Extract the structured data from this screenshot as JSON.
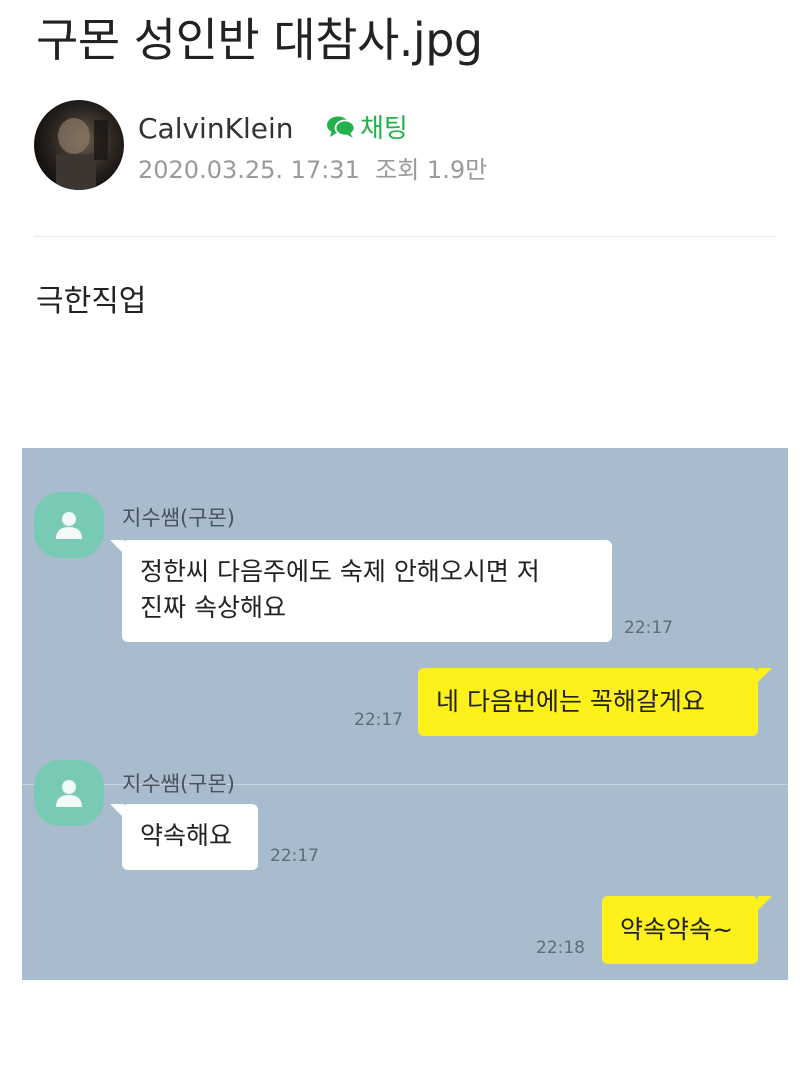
{
  "post": {
    "title": "구몬 성인반 대참사.jpg",
    "author": "CalvinKlein",
    "chat_label": "채팅",
    "date": "2020.03.25. 17:31",
    "views_label": "조회",
    "views": "1.9만",
    "body": "극한직업"
  },
  "chat": {
    "messages": [
      {
        "side": "in",
        "sender": "지수쌤(구몬)",
        "lines": [
          "정한씨 다음주에도 숙제 안해오시면 저",
          "진짜 속상해요"
        ],
        "time": "22:17"
      },
      {
        "side": "out",
        "lines": [
          "네 다음번에는 꼭해갈게요"
        ],
        "time": "22:17"
      },
      {
        "side": "in",
        "sender": "지수쌤(구몬)",
        "lines": [
          "약속해요"
        ],
        "time": "22:17"
      },
      {
        "side": "out",
        "lines": [
          "약속약속~"
        ],
        "time": "22:18"
      }
    ]
  },
  "colors": {
    "chat_background": "#a9bccd",
    "my_bubble": "#fef01b",
    "their_bubble": "#ffffff",
    "profile": "#78cab4",
    "chat_link": "#22b24c"
  },
  "icons": {
    "avatar": "author-avatar",
    "chat": "speech-bubble-icon",
    "profile": "default-person-icon"
  }
}
